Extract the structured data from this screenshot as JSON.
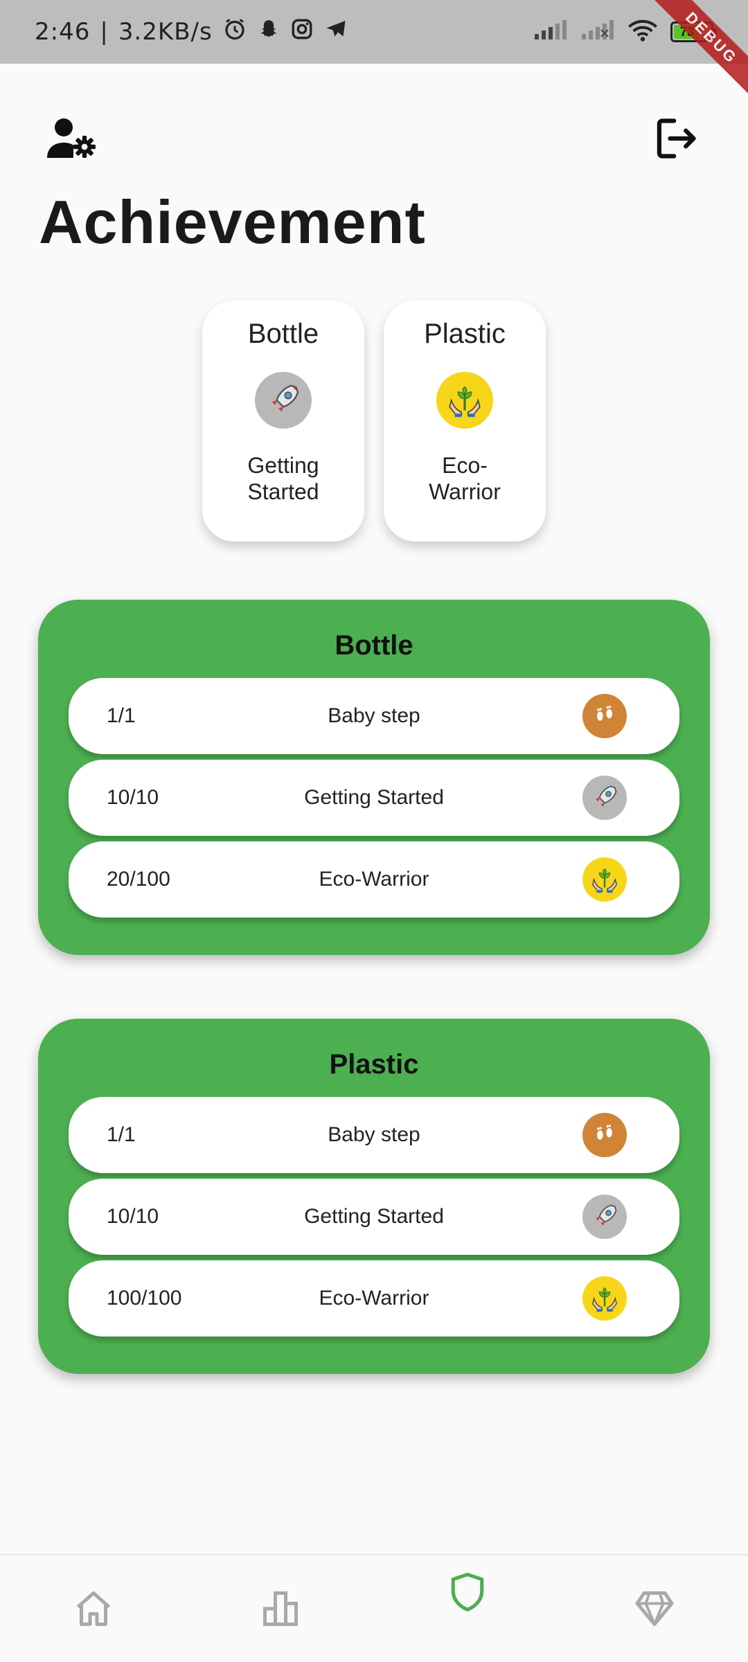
{
  "status_bar": {
    "time": "2:46",
    "speed": "3.2KB/s",
    "battery": "73",
    "debug_label": "DEBUG",
    "icons": [
      "alarm-icon",
      "snapchat-icon",
      "instagram-icon",
      "telegram-icon",
      "signal-icon",
      "signal-icon",
      "wifi-icon",
      "battery-icon"
    ]
  },
  "header": {
    "title": "Achievement",
    "left_icon": "user-settings-icon",
    "right_icon": "logout-icon"
  },
  "top_cards": [
    {
      "title": "Bottle",
      "label": "Getting Started",
      "icon": "rocket-icon",
      "icon_color": "#b8b8b8"
    },
    {
      "title": "Plastic",
      "label": "Eco-Warrior",
      "icon": "plant-hands-icon",
      "icon_color": "#f7d61a"
    }
  ],
  "sections": [
    {
      "title": "Bottle",
      "rows": [
        {
          "progress": "1/1",
          "label": "Baby step",
          "icon": "footprints-icon"
        },
        {
          "progress": "10/10",
          "label": "Getting Started",
          "icon": "rocket-icon"
        },
        {
          "progress": "20/100",
          "label": "Eco-Warrior",
          "icon": "plant-hands-icon"
        }
      ]
    },
    {
      "title": "Plastic",
      "rows": [
        {
          "progress": "1/1",
          "label": "Baby step",
          "icon": "footprints-icon"
        },
        {
          "progress": "10/10",
          "label": "Getting Started",
          "icon": "rocket-icon"
        },
        {
          "progress": "100/100",
          "label": "Eco-Warrior",
          "icon": "plant-hands-icon"
        }
      ]
    }
  ],
  "bottom_nav": [
    {
      "icon": "home-icon",
      "active": false
    },
    {
      "icon": "leaderboard-icon",
      "active": false
    },
    {
      "icon": "shield-icon",
      "active": true
    },
    {
      "icon": "diamond-icon",
      "active": false
    }
  ],
  "colors": {
    "section_bg": "#4caf50",
    "active_nav": "#4caf50",
    "inactive_nav": "#a9a9a9"
  }
}
